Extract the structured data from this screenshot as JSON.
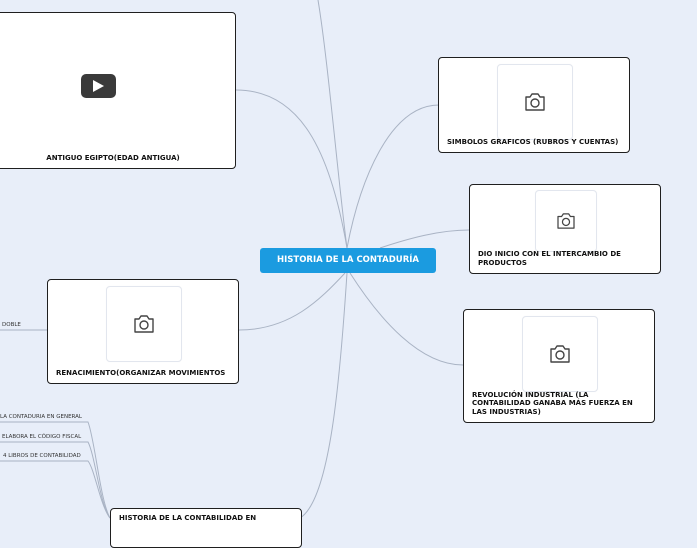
{
  "central": {
    "label": "HISTORIA DE LA CONTADURÍA"
  },
  "nodes": {
    "egipto": {
      "label": "ANTIGUO EGIPTO(EDAD ANTIGUA)"
    },
    "simbolos": {
      "label": "SIMBOLOS GRAFICOS (RUBROS Y CUENTAS)"
    },
    "intercambio": {
      "label": "DIO INICIO CON EL INTERCAMBIO DE PRODUCTOS"
    },
    "revolucion": {
      "label": "REVOLUCIÓN INDUSTRIAL (LA CONTABILIDAD GANABA MÁS FUERZA EN LAS INDUSTRIAS)"
    },
    "renacimiento": {
      "label": "RENACIMIENTO(ORGANIZAR MOVIMIENTOS"
    },
    "historia_en": {
      "label": "HISTORIA DE LA CONTABILIDAD EN"
    }
  },
  "leaves": {
    "doble": "DOBLE",
    "contaduria_general": "LA CONTADURIA EN GENERAL",
    "codigo_fiscal": "ELABORA EL CÓDIGO FISCAL",
    "libros": "4 LIBROS DE CONTABILIDAD"
  },
  "colors": {
    "background": "#e8eef9",
    "central": "#1b9be0",
    "connector": "#a9b3c4",
    "node_border": "#1f1f1f"
  },
  "icons": {
    "video": "play-icon",
    "image": "camera-icon"
  }
}
